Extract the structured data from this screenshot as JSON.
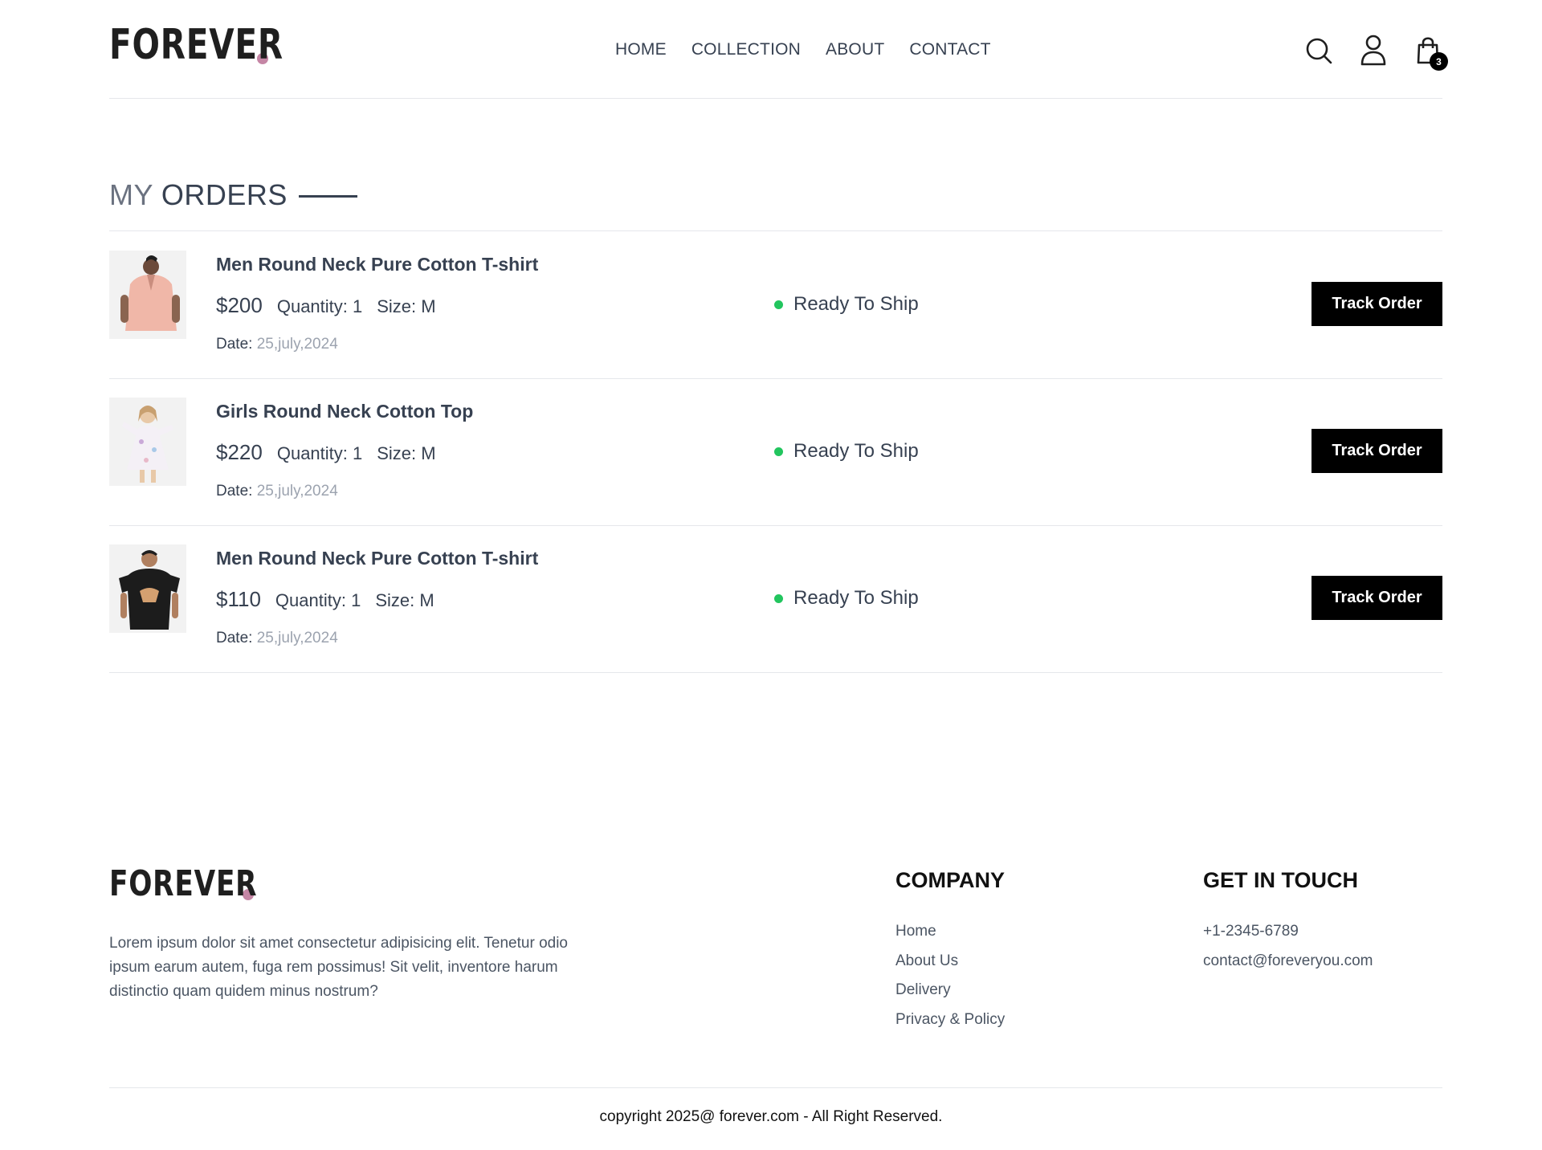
{
  "brand": {
    "logo_text": "FOREVER",
    "accent": "#c586a5"
  },
  "nav": {
    "items": [
      "HOME",
      "COLLECTION",
      "ABOUT",
      "CONTACT"
    ]
  },
  "header_icons": {
    "search": "search-icon",
    "profile": "user-icon",
    "cart": "cart-icon",
    "cart_count": "3"
  },
  "page": {
    "title_light": "MY",
    "title_dark": "ORDERS"
  },
  "orders": [
    {
      "name": "Men Round Neck Pure Cotton T-shirt",
      "price": "$200",
      "quantity": "Quantity: 1",
      "size": "Size: M",
      "date_label": "Date:",
      "date": "25,july,2024",
      "status": "Ready To Ship",
      "button": "Track Order",
      "image": "man-pink-shirt"
    },
    {
      "name": "Girls Round Neck Cotton Top",
      "price": "$220",
      "quantity": "Quantity: 1",
      "size": "Size: M",
      "date_label": "Date:",
      "date": "25,july,2024",
      "status": "Ready To Ship",
      "button": "Track Order",
      "image": "girl-floral-dress"
    },
    {
      "name": "Men Round Neck Pure Cotton T-shirt",
      "price": "$110",
      "quantity": "Quantity: 1",
      "size": "Size: M",
      "date_label": "Date:",
      "date": "25,july,2024",
      "status": "Ready To Ship",
      "button": "Track Order",
      "image": "man-black-tshirt"
    }
  ],
  "status_color": "#22c55e",
  "footer": {
    "logo_text": "FOREVER",
    "description": "Lorem ipsum dolor sit amet consectetur adipisicing elit. Tenetur odio ipsum earum autem, fuga rem possimus! Sit velit, inventore harum distinctio quam quidem minus nostrum?",
    "company_heading": "COMPANY",
    "company_links": [
      "Home",
      "About Us",
      "Delivery",
      "Privacy & Policy"
    ],
    "touch_heading": "GET IN TOUCH",
    "phone": "+1-2345-6789",
    "email": "contact@foreveryou.com",
    "copyright": "copyright 2025@ forever.com - All Right Reserved."
  }
}
